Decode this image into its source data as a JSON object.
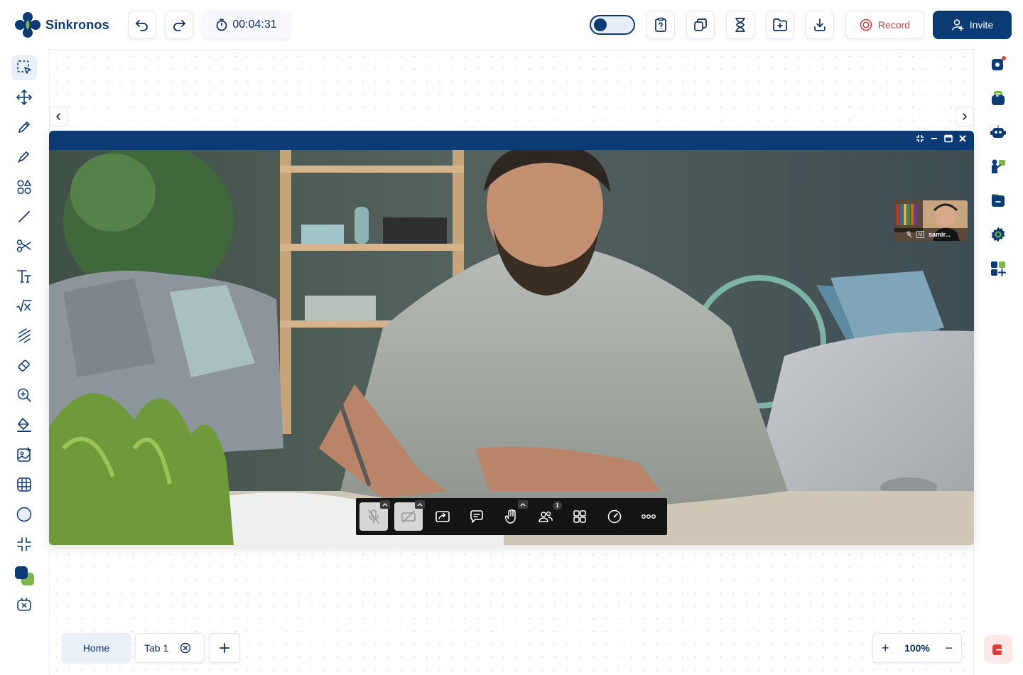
{
  "app": {
    "name": "Sinkronos"
  },
  "header": {
    "timer": "00:04:31",
    "record_label": "Record",
    "invite_label": "Invite"
  },
  "video": {
    "participant_name": "samir...",
    "participant_badge": "M",
    "participant_count": "1"
  },
  "tabs": [
    {
      "label": "Home"
    },
    {
      "label": "Tab 1"
    }
  ],
  "zoom": {
    "level": "100%",
    "plus": "+",
    "minus": "−"
  },
  "colors": {
    "brand": "#0b3a75",
    "accent_green": "#7ab648",
    "record_red": "#d9363e"
  }
}
